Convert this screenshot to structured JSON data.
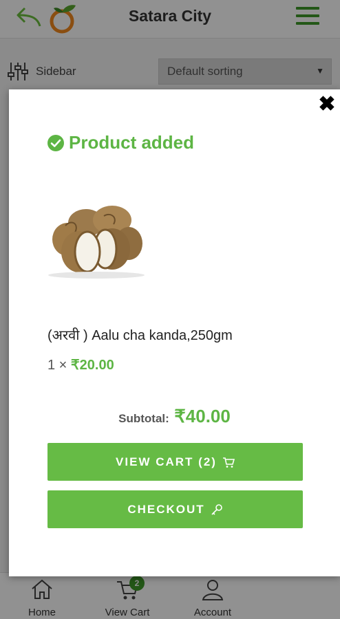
{
  "header": {
    "title": "Satara City",
    "back_icon": "back-arrow-icon",
    "logo_icon": "orange-fruit-logo",
    "menu_icon": "hamburger-menu-icon"
  },
  "toolbar": {
    "sidebar_label": "Sidebar",
    "sort_selected": "Default sorting"
  },
  "bottom_nav": {
    "items": [
      {
        "label": "Home",
        "icon": "home-icon"
      },
      {
        "label": "View Cart",
        "icon": "cart-icon",
        "badge": "2"
      },
      {
        "label": "Account",
        "icon": "account-icon"
      }
    ]
  },
  "modal": {
    "close_symbol": "✖",
    "status_title": "Product added",
    "product": {
      "name": "(अरवी ) Aalu cha kanda,250gm",
      "qty_prefix": "1 ×",
      "price": "₹20.00",
      "image": "taro-root-image"
    },
    "subtotal_label": "Subtotal:",
    "subtotal_value": "₹40.00",
    "view_cart_label": "VIEW CART (2)",
    "checkout_label": "CHECKOUT"
  },
  "colors": {
    "accent": "#5db544",
    "button": "#66bb45",
    "brand_dark": "#3f9a2a"
  }
}
